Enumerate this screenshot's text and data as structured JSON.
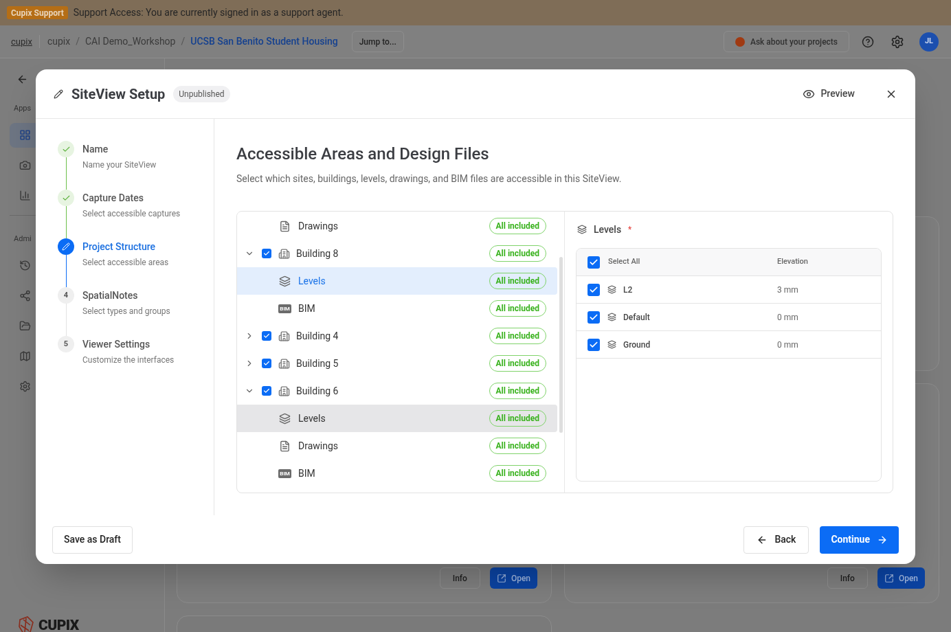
{
  "banner": {
    "badge": "Cupix Support",
    "message": "Support Access: You are currently signed in as a support agent."
  },
  "header": {
    "home_link": "cupix",
    "breadcrumbs": [
      "cupix",
      "CAI Demo_Workshop",
      "UCSB San Benito Student Housing"
    ],
    "separators": [
      "/",
      "/"
    ],
    "jump_button": "Jump to...",
    "ask_button": "Ask about your projects",
    "avatar": "JL"
  },
  "sidebar": {
    "section_labels": [
      "Apps",
      "Admi"
    ],
    "app_items": [
      {
        "kind": "apps",
        "selected": true
      },
      {
        "kind": "camera",
        "selected": false
      },
      {
        "kind": "chart",
        "selected": false
      }
    ],
    "admin_items": [
      {
        "kind": "history",
        "selected": false
      },
      {
        "kind": "share",
        "selected": false
      },
      {
        "kind": "folder",
        "selected": false
      },
      {
        "kind": "map",
        "selected": false
      },
      {
        "kind": "settings",
        "selected": false
      }
    ],
    "logo": "CUPIX"
  },
  "cards": [
    {
      "info": "Info",
      "open": "Open"
    },
    {
      "info": "Info",
      "open": "Open"
    }
  ],
  "modal": {
    "title": "SiteView Setup",
    "status": "Unpublished",
    "preview": "Preview",
    "steps": [
      {
        "title": "Name",
        "subtitle": "Name your SiteView",
        "done": true,
        "current": false
      },
      {
        "title": "Capture Dates",
        "subtitle": "Select accessible captures",
        "done": true,
        "current": false
      },
      {
        "title": "Project Structure",
        "subtitle": "Select accessible areas",
        "done": false,
        "current": true
      },
      {
        "number": "4",
        "title": "SpatialNotes",
        "subtitle": "Select types and groups",
        "done": false,
        "current": false
      },
      {
        "number": "5",
        "title": "Viewer Settings",
        "subtitle": "Customize the interfaces",
        "done": false,
        "current": false
      }
    ],
    "heading": "Accessible Areas and Design Files",
    "description": "Select which sites, buildings, levels, drawings, and BIM files are accessible in this SiteView.",
    "tree": [
      {
        "kind": "drawings",
        "label": "Drawings",
        "badge": "All included",
        "selected": false,
        "hovered": false
      },
      {
        "kind": "building",
        "label": "Building 8",
        "badge": "All included",
        "checked": true,
        "expanded": true,
        "selected": false,
        "hovered": false,
        "children": [
          {
            "kind": "levels",
            "label": "Levels",
            "badge": "All included",
            "selected": true,
            "hovered": false
          },
          {
            "kind": "bim",
            "icon_label": "BIM",
            "label": "BIM",
            "badge": "All included",
            "selected": false,
            "hovered": false
          }
        ]
      },
      {
        "kind": "building",
        "label": "Building 4",
        "badge": "All included",
        "checked": true,
        "expanded": false,
        "selected": false,
        "hovered": false
      },
      {
        "kind": "building",
        "label": "Building 5",
        "badge": "All included",
        "checked": true,
        "expanded": false,
        "selected": false,
        "hovered": false
      },
      {
        "kind": "building",
        "label": "Building 6",
        "badge": "All included",
        "checked": true,
        "expanded": true,
        "selected": false,
        "hovered": false,
        "children": [
          {
            "kind": "levels",
            "label": "Levels",
            "badge": "All included",
            "selected": false,
            "hovered": true
          },
          {
            "kind": "drawings",
            "label": "Drawings",
            "badge": "All included",
            "selected": false,
            "hovered": false
          },
          {
            "kind": "bim",
            "icon_label": "BIM",
            "label": "BIM",
            "badge": "All included",
            "selected": false,
            "hovered": false
          }
        ]
      }
    ],
    "detail": {
      "title": "Levels",
      "required": "*",
      "select_all": "Select All",
      "select_all_checked": true,
      "elevation_header": "Elevation",
      "rows": [
        {
          "name": "L2",
          "elevation": "3 mm",
          "checked": true
        },
        {
          "name": "Default",
          "elevation": "0 mm",
          "checked": true
        },
        {
          "name": "Ground",
          "elevation": "0 mm",
          "checked": true
        }
      ]
    },
    "save_draft": "Save as Draft",
    "back": "Back",
    "continue": "Continue"
  }
}
